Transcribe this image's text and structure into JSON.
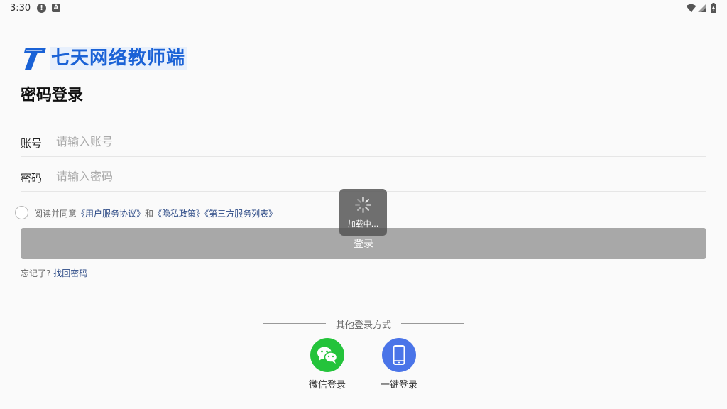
{
  "status_bar": {
    "time": "3:30",
    "alert_glyph": "!",
    "a_glyph": "A",
    "icons": [
      "alert-icon",
      "a-icon",
      "wifi-icon",
      "signal-icon",
      "battery-icon"
    ]
  },
  "logo": {
    "text": "七天网络教师端",
    "brand_color": "#1a62d6"
  },
  "page_title": "密码登录",
  "account": {
    "label": "账号",
    "value": "",
    "placeholder": "请输入账号"
  },
  "password": {
    "label": "密码",
    "value": "",
    "placeholder": "请输入密码"
  },
  "agreement": {
    "prefix": "阅读并同意",
    "link_user": "《用户服务协议》",
    "and": "和",
    "link_privacy": "《隐私政策》",
    "link_third": "《第三方服务列表》"
  },
  "login_button": "登录",
  "forgot": {
    "prompt": "忘记了?",
    "link": "找回密码"
  },
  "loading": {
    "text": "加载中..."
  },
  "other_login": {
    "title": "其他登录方式",
    "options": [
      {
        "label": "微信登录",
        "icon": "wechat-icon",
        "color": "#24c33b"
      },
      {
        "label": "一键登录",
        "icon": "phone-icon",
        "color": "#4a74e8"
      }
    ]
  }
}
